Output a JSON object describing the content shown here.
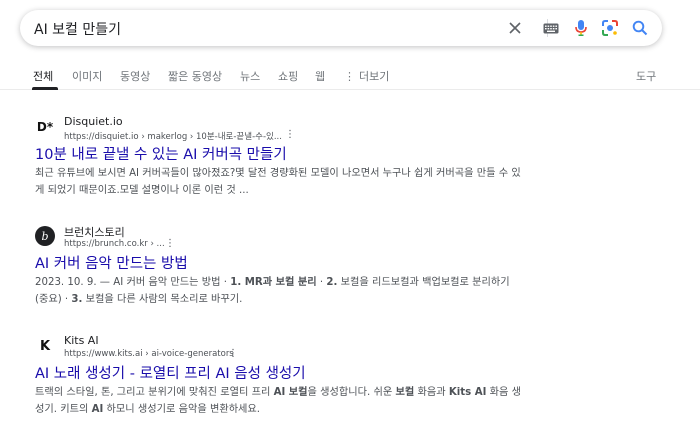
{
  "search": {
    "query": "AI 보컬 만들기"
  },
  "icons": {
    "clear": "close-icon",
    "keyboard": "keyboard-icon",
    "voice": "microphone-icon",
    "lens": "camera-lens-icon",
    "search": "search-icon"
  },
  "colors": {
    "link": "#1a0dab",
    "text": "#202124",
    "snippet": "#4d5156",
    "google_blue": "#4285f4",
    "google_red": "#ea4335",
    "google_yellow": "#fbbc05",
    "google_green": "#34a853"
  },
  "tabs": [
    {
      "label": "전체",
      "active": true
    },
    {
      "label": "이미지"
    },
    {
      "label": "동영상"
    },
    {
      "label": "짧은 동영상"
    },
    {
      "label": "뉴스"
    },
    {
      "label": "쇼핑"
    },
    {
      "label": "웹"
    },
    {
      "label": "더보기"
    }
  ],
  "tools_label": "도구",
  "results": [
    {
      "favicon_text": "D*",
      "site": "Disquiet.io",
      "url": "https://disquiet.io › makerlog › 10분-내로-끝낼-수-있...",
      "title": "10분 내로 끝낼 수 있는 AI 커버곡 만들기",
      "snippet": "최근 유튜브에 보시면 AI 커버곡들이 많아졌죠?몇 달전 경량화된 모델이 나오면서 누구나 쉽게 커버곡을 만들 수 있게 되었기 때문이죠.모델 설명이나 이론 이런 것 ..."
    },
    {
      "favicon_text": "b",
      "site": "브런치스토리",
      "url": "https://brunch.co.kr › ...",
      "title": "AI 커버 음악 만드는 방법",
      "snippet_date": "2023. 10. 9. —",
      "snippet_parts": [
        {
          "t": " AI 커버 음악 만드는 방법 · ",
          "b": false
        },
        {
          "t": "1. MR과 보컬 분리",
          "b": true
        },
        {
          "t": " · ",
          "b": false
        },
        {
          "t": "2.",
          "b": true
        },
        {
          "t": " 보컬을 리드보컬과 백업보컬로 분리하기 (중요) · ",
          "b": false
        },
        {
          "t": "3.",
          "b": true
        },
        {
          "t": " 보컬을 다른 사람의 목소리로 바꾸기.",
          "b": false
        }
      ]
    },
    {
      "favicon_text": "K",
      "site": "Kits AI",
      "url": "https://www.kits.ai › ai-voice-generators",
      "title": "AI 노래 생성기 - 로열티 프리 AI 음성 생성기",
      "snippet_parts": [
        {
          "t": "트랙의 스타일, 톤, 그리고 분위기에 맞춰진 로열티 프리 ",
          "b": false
        },
        {
          "t": "AI 보컬",
          "b": true
        },
        {
          "t": "을 생성합니다. 쉬운 ",
          "b": false
        },
        {
          "t": "보컬",
          "b": true
        },
        {
          "t": " 화음과 ",
          "b": false
        },
        {
          "t": "Kits AI",
          "b": true
        },
        {
          "t": " 화음 생성기. 키트의 ",
          "b": false
        },
        {
          "t": "AI",
          "b": true
        },
        {
          "t": " 하모니 생성기로 음악을 변환하세요.",
          "b": false
        }
      ]
    }
  ]
}
